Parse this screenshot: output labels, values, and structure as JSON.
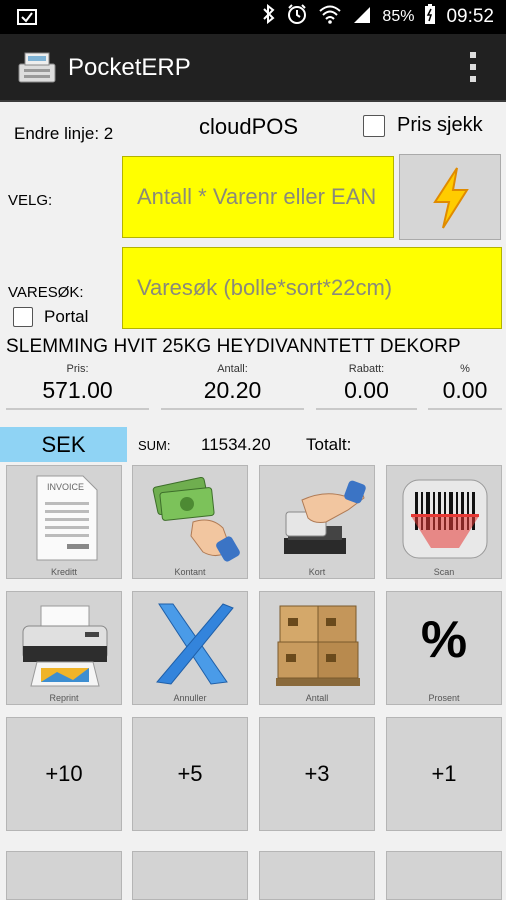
{
  "status": {
    "battery": "85%",
    "time": "09:52"
  },
  "app": {
    "title": "PocketERP"
  },
  "header": {
    "edit_line": "Endre linje: 2",
    "pos_name": "cloudPOS",
    "price_check_label": "Pris sjekk"
  },
  "select": {
    "label": "VELG:",
    "placeholder": "Antall * Varenr eller EAN"
  },
  "search": {
    "label": "VARESØK:",
    "placeholder": "Varesøk (bolle*sort*22cm)",
    "portal_label": "Portal"
  },
  "product": {
    "name": "SLEMMING HVIT 25KG HEYDIVANNTETT DEKORP",
    "price_label": "Pris:",
    "price": "571.00",
    "qty_label": "Antall:",
    "qty": "20.20",
    "discount_label": "Rabatt:",
    "discount": "0.00",
    "percent_label": "%",
    "percent": "0.00"
  },
  "totals": {
    "currency": "SEK",
    "sum_label": "SUM:",
    "sum": "11534.20",
    "total_label": "Totalt:"
  },
  "tiles": {
    "credit": "Kreditt",
    "cash": "Kontant",
    "card": "Kort",
    "scan": "Scan",
    "reprint": "Reprint",
    "cancel": "Annuller",
    "quantity": "Antall",
    "percent": "Prosent",
    "plus10": "+10",
    "plus5": "+5",
    "plus3": "+3",
    "plus1": "+1"
  },
  "colors": {
    "input_bg": "#ffff00",
    "currency_bg": "#8fd3f4",
    "tile_bg": "#d3d3d3"
  }
}
